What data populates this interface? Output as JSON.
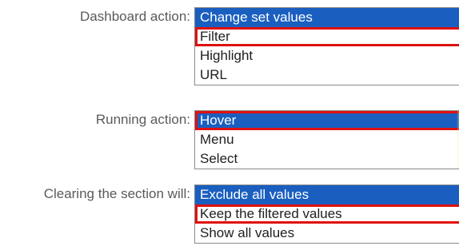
{
  "groups": [
    {
      "label": "Dashboard action:",
      "options": [
        {
          "text": "Change set values",
          "selected": true,
          "marked": false
        },
        {
          "text": "Filter",
          "selected": false,
          "marked": true
        },
        {
          "text": "Highlight",
          "selected": false,
          "marked": false
        },
        {
          "text": "URL",
          "selected": false,
          "marked": false
        }
      ]
    },
    {
      "label": "Running action:",
      "options": [
        {
          "text": "Hover",
          "selected": true,
          "marked": true
        },
        {
          "text": "Menu",
          "selected": false,
          "marked": false
        },
        {
          "text": "Select",
          "selected": false,
          "marked": false
        }
      ]
    },
    {
      "label": "Clearing the section will:",
      "options": [
        {
          "text": "Exclude all values",
          "selected": true,
          "marked": false
        },
        {
          "text": "Keep the filtered values",
          "selected": false,
          "marked": true
        },
        {
          "text": "Show all values",
          "selected": false,
          "marked": false
        }
      ]
    }
  ],
  "colors": {
    "selected_bg": "#1a5fc0",
    "highlight_outline": "#e01010",
    "label_text": "#5a5a5a"
  }
}
